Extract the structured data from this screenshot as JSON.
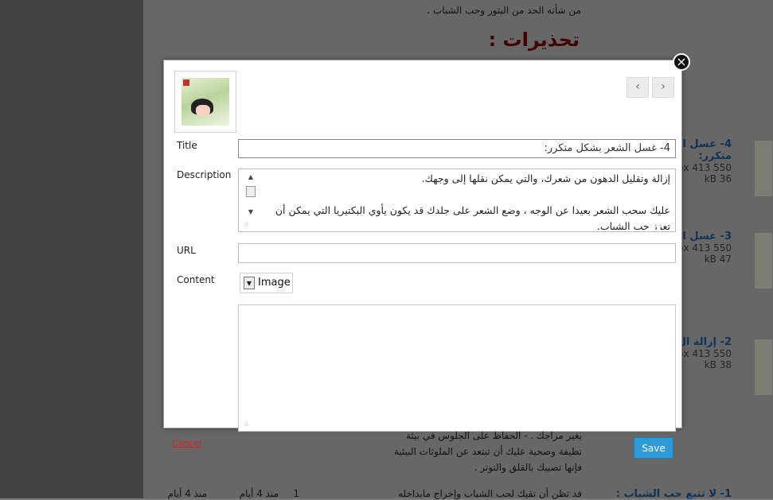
{
  "background": {
    "top_text_1": "من شأنه الحد من البثور وحب الشباب .",
    "top_text_2": "",
    "heading": "تحذيرات :",
    "side_items": [
      {
        "title": "4- غسل ا",
        "title2": "متكرر:",
        "dims": "550 px 413",
        "size": "36 kB"
      },
      {
        "title": "3- غسل ا",
        "title2": "",
        "dims": "550 px 413",
        "size": "47 kB"
      },
      {
        "title": "2- إزالة ال",
        "title2": "",
        "dims": "550 px 413",
        "size": "38 kB"
      }
    ],
    "bottom_lines": [
      "يغير مزاجك . - الحفاظ على الجلوس في بيئة",
      "نظيفة وصحية عليك أن تبتعد عن الملوثات البيئية",
      "فإنها تصيبك بالقلق والتوتر ."
    ],
    "bottom_row": {
      "title": "1- لا تتبع حب الشباب :",
      "text": "قد تظن أن تقيك لحب الشباب وإخراج مابداخله",
      "count": "1",
      "ago_1": "منذ 4 أيام",
      "ago_2": "منذ 4 أيام",
      "ago_3": "منذ 4 أيام"
    }
  },
  "modal": {
    "close_icon": "close-icon",
    "labels": {
      "title": "Title",
      "description": "Description",
      "url": "URL",
      "content": "Content"
    },
    "title_value": "4- غسل الشعر بشكل متكرر:",
    "description_value": "إزالة وتقليل الدهون  من شعرك، والتي يمكن نقلها إلى وجهك.\n\nعليك سحب الشعر بعيدا عن الوجه ، وضع الشعر على جلدك قد يكون يأوي البكتيريا التي يمكن أن تعزز حب الشباب.",
    "url_value": "",
    "content_type": "Image",
    "content_value": "",
    "nav": {
      "prev": "‹",
      "next": "›"
    }
  },
  "actions": {
    "cancel": "Cancel",
    "save": "Save"
  },
  "colors": {
    "save_bg": "#2f9ad8",
    "cancel": "#e02020",
    "heading": "#7a0000"
  }
}
